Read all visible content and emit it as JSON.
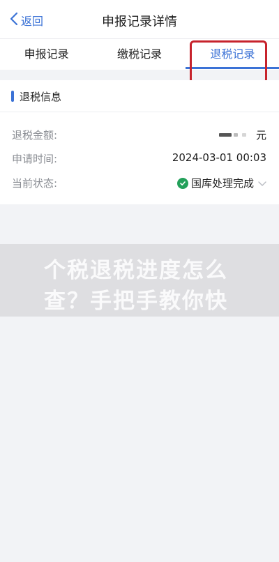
{
  "navbar": {
    "back_label": "返回",
    "title": "申报记录详情"
  },
  "tabs": [
    {
      "label": "申报记录",
      "active": false
    },
    {
      "label": "缴税记录",
      "active": false
    },
    {
      "label": "退税记录",
      "active": true
    }
  ],
  "refund_info": {
    "section_title": "退税信息",
    "rows": [
      {
        "label": "退税金额:",
        "value": "元"
      },
      {
        "label": "申请时间:",
        "value": "2024-03-01 00:03"
      },
      {
        "label": "当前状态:",
        "value": "国库处理完成"
      }
    ]
  },
  "watermark": {
    "line1": "个税退税进度怎么",
    "line2": "查？手把手教你快"
  },
  "colors": {
    "accent": "#3b72d6",
    "success": "#23a05a",
    "highlight": "#c7232c"
  }
}
